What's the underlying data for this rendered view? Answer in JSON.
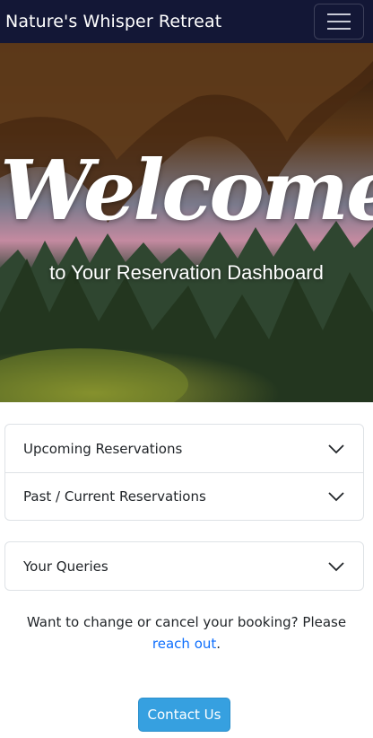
{
  "navbar": {
    "brand": "Nature's Whisper Retreat",
    "menu_icon": "hamburger-menu-icon",
    "background_color": "#131736"
  },
  "hero": {
    "welcome": "Welcome",
    "subtitle": "to Your Reservation Dashboard"
  },
  "accordion_groups": [
    {
      "items": [
        {
          "label": "Upcoming Reservations",
          "icon": "chevron-down-icon"
        },
        {
          "label": "Past / Current Reservations",
          "icon": "chevron-down-icon"
        }
      ]
    },
    {
      "items": [
        {
          "label": "Your Queries",
          "icon": "chevron-down-icon"
        }
      ]
    }
  ],
  "note": {
    "text": "Want to change or cancel your booking? Please ",
    "link": "reach out",
    "suffix": "."
  },
  "contact_button": {
    "label": "Contact Us",
    "color": "#36a0e0"
  }
}
